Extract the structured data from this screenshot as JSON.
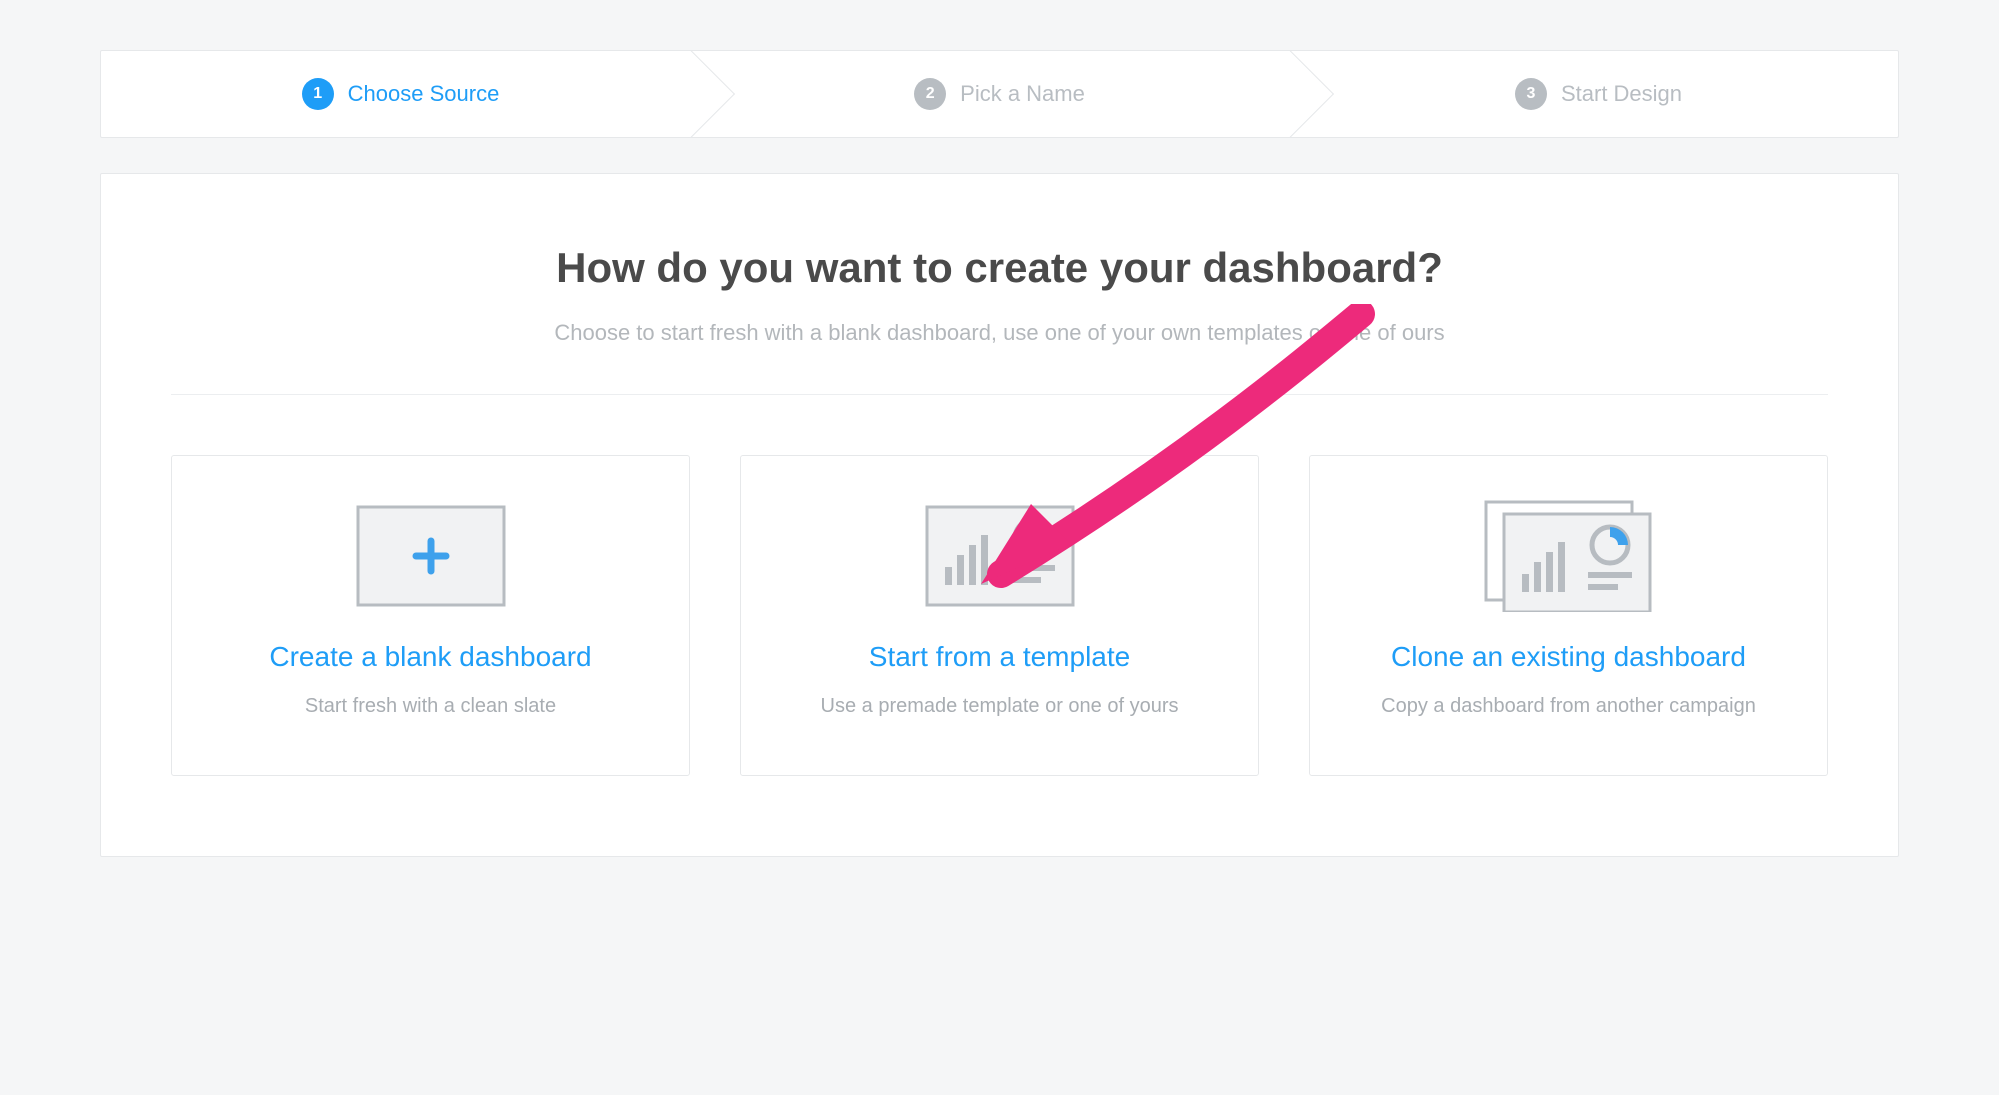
{
  "stepper": {
    "steps": [
      {
        "num": "1",
        "label": "Choose Source",
        "active": true
      },
      {
        "num": "2",
        "label": "Pick a Name",
        "active": false
      },
      {
        "num": "3",
        "label": "Start Design",
        "active": false
      }
    ]
  },
  "panel": {
    "title": "How do you want to create your dashboard?",
    "subtitle": "Choose to start fresh with a blank dashboard, use one of your own templates or one of ours"
  },
  "cards": [
    {
      "title": "Create a blank dashboard",
      "desc": "Start fresh with a clean slate"
    },
    {
      "title": "Start from a template",
      "desc": "Use a premade template or one of yours"
    },
    {
      "title": "Clone an existing dashboard",
      "desc": "Copy a dashboard from another campaign"
    }
  ],
  "annotation": {
    "arrow_color": "#ed2a7b"
  }
}
